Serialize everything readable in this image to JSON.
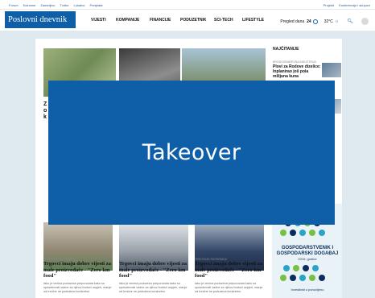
{
  "topbar": {
    "left": [
      "Forum",
      "Kolumne",
      "Zanimljivo",
      "Tvrtke",
      "Lokalno",
      "Pretplata"
    ],
    "right": [
      "Projekti",
      "Konferencije i skupovi"
    ]
  },
  "header": {
    "logo": "Poslovni dnevnik",
    "nav": [
      "VIJESTI",
      "KOMPANIJE",
      "FINANCIJE",
      "PODUZETNIK",
      "SCI-TECH",
      "LIFESTYLE"
    ],
    "pageview_label": "Pregled dana",
    "pageview_value": "24",
    "temperature": "32°C"
  },
  "sidebar": {
    "title": "NAJČITANIJE",
    "items": [
      {
        "category": "BRODOGRAĐEVNA INDUSTRIJA",
        "headline": "Plovi za Rodove dizelice: Inplanirao još pola milijuna kuna"
      }
    ]
  },
  "left_fragment": "Z\no\nk",
  "ad": {
    "title": "GOSPODARSTVENIK I GOSPODARSKI DOGAĐAJ",
    "year": "2015. godine",
    "footer": "Investirati u ponovljenu"
  },
  "cards": [
    {
      "category": "TREĆENJE EKONOMIJA",
      "title": "Trgovci imaju dobre vijesti za male proizvođače - \"Zero km food\"",
      "text": "Iako je većina poduzeća preporučala kako su sposobnosti važne za njihov budući uspjeh, manje od trećine ne poduzima konkretno"
    },
    {
      "category": "TREĆENJE EKONOMIJA",
      "title": "Trgovci imaju dobre vijesti za male proizvođače - \"Zero km food\"",
      "text": "Iako je većina poduzeća preporučala kako su sposobnosti važne za njihov budući uspjeh, manje od trećine ne poduzima konkretno"
    },
    {
      "category": "TREĆENJE EKONOMIJA",
      "title": "Trgovci imaju dobre vijesti za male proizvođače - \"Zero km food\"",
      "text": "Iako je većina poduzeća preporučala kako su sposobnosti važne za njihov budući uspjeh, manje od trećine ne poduzima konkretno"
    }
  ],
  "overlay": {
    "label": "Takeover",
    "color": "#0f5fa8"
  },
  "icons": {
    "pageview": "ring-icon",
    "weather": "sun-icon",
    "search": "search-icon",
    "user": "user-icon"
  }
}
